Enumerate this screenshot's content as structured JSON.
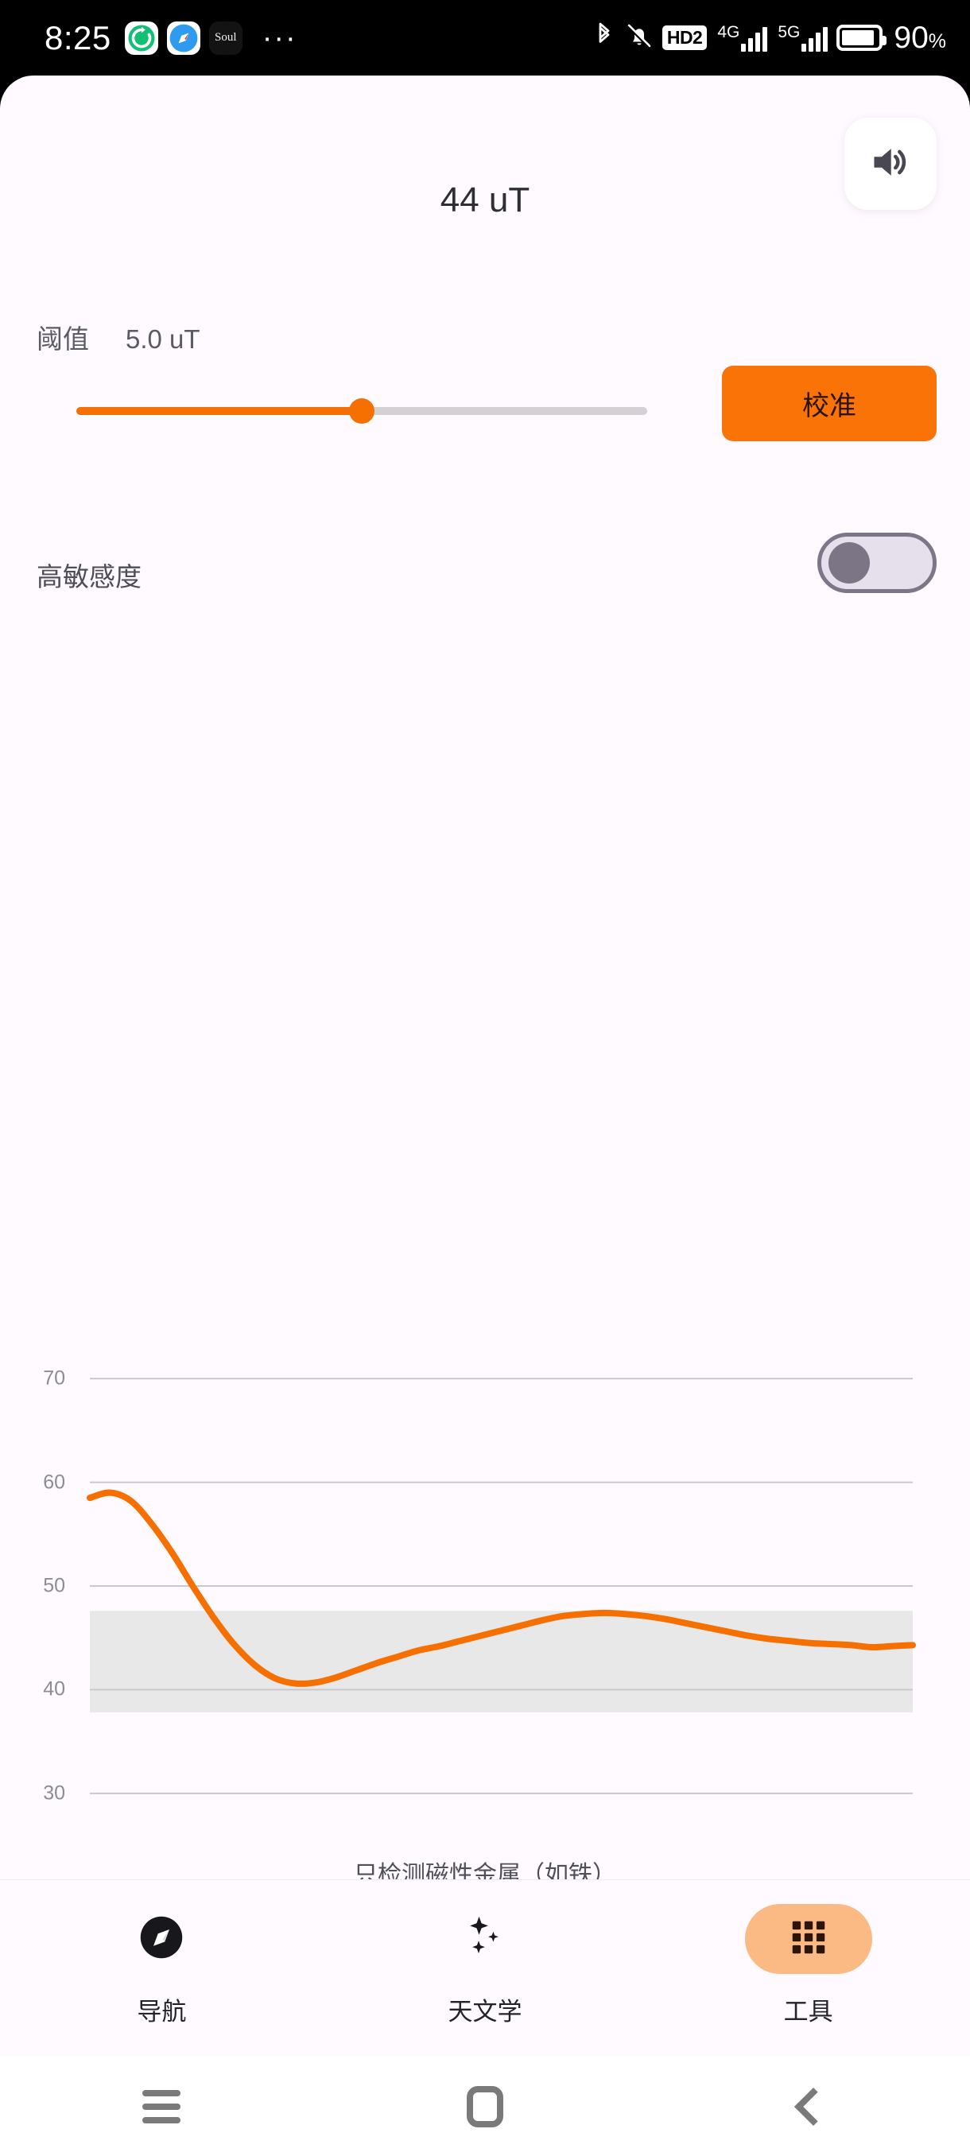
{
  "status_bar": {
    "time": "8:25",
    "app_icons": [
      "sync-app-icon",
      "compass-app-icon",
      "soul-app-icon"
    ],
    "soul_label": "Soul",
    "overflow": "···",
    "right_icons": [
      "bluetooth-icon",
      "silent-bell-icon",
      "hd2-icon",
      "signal-4g-icon",
      "signal-5g-icon",
      "battery-icon"
    ],
    "hd_label": "HD2",
    "net_4g": "4G",
    "net_5g": "5G",
    "battery_percent": "90",
    "battery_percent_sign": "%"
  },
  "header": {
    "title": "44 uT",
    "speaker_icon": "volume-on-icon"
  },
  "threshold": {
    "label": "阈值",
    "value": "5.0 uT",
    "slider_percent": 50
  },
  "calibrate": {
    "label": "校准"
  },
  "sensitivity": {
    "label": "高敏感度",
    "enabled": false
  },
  "chart_data": {
    "type": "line",
    "title": "",
    "caption": "只检测磁性金属（如铁）",
    "xlabel": "",
    "ylabel": "",
    "ylim": [
      27,
      73
    ],
    "yticks": [
      70,
      60,
      50,
      40,
      30
    ],
    "ytick_labels": [
      "70",
      "60",
      "50",
      "40",
      "30"
    ],
    "grid": true,
    "legend": "none",
    "line_color": "#f57000",
    "band": {
      "from": 37.8,
      "to": 47.6,
      "color": "#e8e8e8"
    },
    "series": [
      {
        "name": "magnetic-field",
        "color": "#f57000",
        "x": [
          0,
          1,
          2,
          3,
          4,
          5,
          6,
          7,
          8,
          9,
          10,
          11,
          12,
          13,
          14,
          15,
          16,
          17,
          18,
          19,
          20,
          21,
          22,
          23,
          24,
          25,
          26,
          27,
          28,
          29,
          30,
          31,
          32,
          33,
          34,
          35,
          36,
          37,
          38,
          39,
          40
        ],
        "values": [
          58.5,
          59.0,
          58.2,
          56.0,
          53.2,
          50.0,
          47.0,
          44.4,
          42.4,
          41.1,
          40.6,
          40.7,
          41.2,
          41.9,
          42.6,
          43.2,
          43.8,
          44.2,
          44.7,
          45.2,
          45.7,
          46.2,
          46.7,
          47.1,
          47.3,
          47.4,
          47.3,
          47.1,
          46.8,
          46.4,
          46.0,
          45.6,
          45.2,
          44.9,
          44.7,
          44.5,
          44.4,
          44.3,
          44.1,
          44.2,
          44.3
        ]
      }
    ]
  },
  "tabs": [
    {
      "label": "导航",
      "icon": "compass-icon",
      "active": false
    },
    {
      "label": "天文学",
      "icon": "sparkles-icon",
      "active": false
    },
    {
      "label": "工具",
      "icon": "grid-icon",
      "active": true
    }
  ],
  "system_nav": {
    "menu": "menu-icon",
    "home": "home-icon",
    "back": "back-icon"
  },
  "colors": {
    "accent": "#f57000",
    "button": "#f97306",
    "tab_active_pill": "#fbb983",
    "app_background": "#fffaff",
    "band": "#e8e8e8"
  }
}
